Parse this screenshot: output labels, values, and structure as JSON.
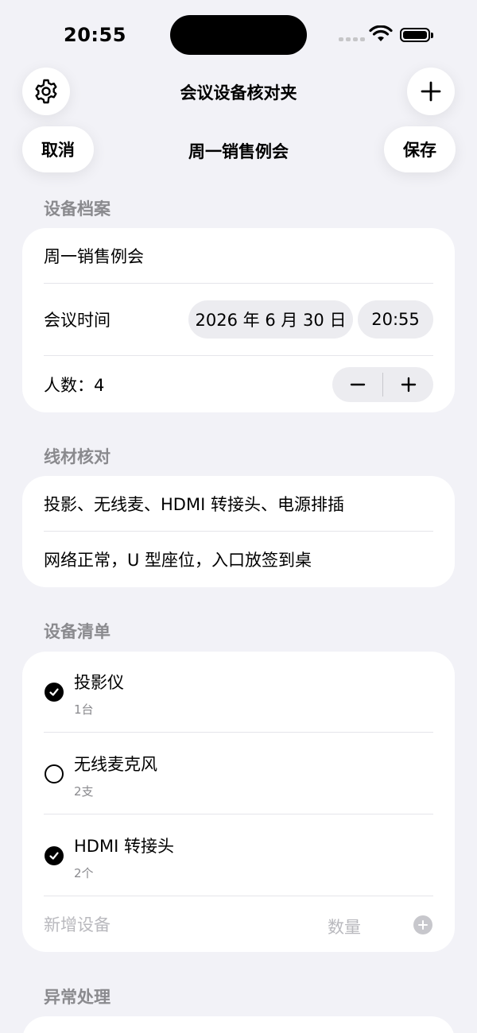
{
  "status_bar": {
    "time": "20:55"
  },
  "toolbar": {
    "title": "会议设备核对夹"
  },
  "nav": {
    "cancel_label": "取消",
    "title": "周一销售例会",
    "save_label": "保存"
  },
  "profile_section": {
    "header": "设备档案",
    "meeting_name": "周一销售例会",
    "time_label": "会议时间",
    "date_value": "2026 年 6 月 30 日",
    "time_value": "20:55",
    "count_label": "人数：4"
  },
  "cable_section": {
    "header": "线材核对",
    "items": [
      "投影、无线麦、HDMI 转接头、电源排插",
      "网络正常，U 型座位，入口放签到桌"
    ]
  },
  "equipment_section": {
    "header": "设备清单",
    "items": [
      {
        "name": "投影仪",
        "qty": "1台",
        "checked": true
      },
      {
        "name": "无线麦克风",
        "qty": "2支",
        "checked": false
      },
      {
        "name": "HDMI 转接头",
        "qty": "2个",
        "checked": true
      }
    ],
    "new_item_placeholder": "新增设备",
    "qty_placeholder": "数量"
  },
  "exception_section": {
    "header": "异常处理"
  },
  "icons": {
    "settings": "gear-icon",
    "add": "plus-icon",
    "decrement": "minus-icon",
    "increment": "plus-icon",
    "add_item": "plus-circle-icon"
  },
  "colors": {
    "background": "#f2f2f7",
    "card": "#ffffff",
    "secondary_text": "#8a8a8e",
    "chip": "#ececf0"
  }
}
